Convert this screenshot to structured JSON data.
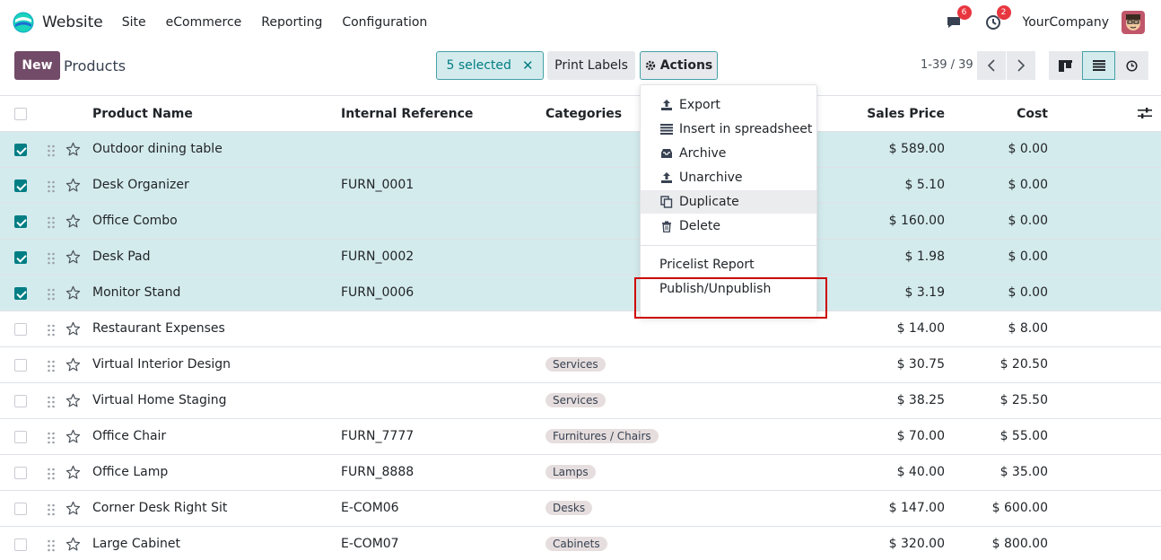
{
  "app": {
    "title": "Website",
    "menu": [
      "Site",
      "eCommerce",
      "Reporting",
      "Configuration"
    ],
    "messages_count": "6",
    "activities_count": "2",
    "company": "YourCompany"
  },
  "control": {
    "new_label": "New",
    "title": "Products",
    "selected_label": "5 selected",
    "clear_icon": "✕",
    "print_label": "Print Labels",
    "actions_label": "Actions",
    "pager": "1-39 / 39"
  },
  "columns": {
    "name": "Product Name",
    "ref": "Internal Reference",
    "categ": "Categories",
    "price": "Sales Price",
    "cost": "Cost"
  },
  "rows": [
    {
      "name": "Outdoor dining table",
      "ref": "",
      "categ": "",
      "price": "$ 589.00",
      "cost": "$ 0.00",
      "selected": true
    },
    {
      "name": "Desk Organizer",
      "ref": "FURN_0001",
      "categ": "",
      "price": "$ 5.10",
      "cost": "$ 0.00",
      "selected": true
    },
    {
      "name": "Office Combo",
      "ref": "",
      "categ": "",
      "price": "$ 160.00",
      "cost": "$ 0.00",
      "selected": true
    },
    {
      "name": "Desk Pad",
      "ref": "FURN_0002",
      "categ": "",
      "price": "$ 1.98",
      "cost": "$ 0.00",
      "selected": true
    },
    {
      "name": "Monitor Stand",
      "ref": "FURN_0006",
      "categ": "",
      "price": "$ 3.19",
      "cost": "$ 0.00",
      "selected": true
    },
    {
      "name": "Restaurant Expenses",
      "ref": "",
      "categ": "",
      "price": "$ 14.00",
      "cost": "$ 8.00",
      "selected": false
    },
    {
      "name": "Virtual Interior Design",
      "ref": "",
      "categ": "Services",
      "price": "$ 30.75",
      "cost": "$ 20.50",
      "selected": false
    },
    {
      "name": "Virtual Home Staging",
      "ref": "",
      "categ": "Services",
      "price": "$ 38.25",
      "cost": "$ 25.50",
      "selected": false
    },
    {
      "name": "Office Chair",
      "ref": "FURN_7777",
      "categ": "Furnitures / Chairs",
      "price": "$ 70.00",
      "cost": "$ 55.00",
      "selected": false
    },
    {
      "name": "Office Lamp",
      "ref": "FURN_8888",
      "categ": "Lamps",
      "price": "$ 40.00",
      "cost": "$ 35.00",
      "selected": false
    },
    {
      "name": "Corner Desk Right Sit",
      "ref": "E-COM06",
      "categ": "Desks",
      "price": "$ 147.00",
      "cost": "$ 600.00",
      "selected": false
    },
    {
      "name": "Large Cabinet",
      "ref": "E-COM07",
      "categ": "Cabinets",
      "price": "$ 320.00",
      "cost": "$ 800.00",
      "selected": false
    }
  ],
  "actions_menu": {
    "items": [
      {
        "label": "Export",
        "icon": "upload-icon"
      },
      {
        "label": "Insert in spreadsheet",
        "icon": "list-icon"
      },
      {
        "label": "Archive",
        "icon": "inbox-icon"
      },
      {
        "label": "Unarchive",
        "icon": "upload-icon"
      },
      {
        "label": "Duplicate",
        "icon": "copy-icon"
      },
      {
        "label": "Delete",
        "icon": "trash-icon"
      }
    ],
    "extra": [
      "Pricelist Report",
      "Publish/Unpublish"
    ],
    "highlighted": "Duplicate"
  },
  "colors": {
    "brand": "#714b67",
    "accent": "#017e84",
    "selected_row": "#d4ebed",
    "annotation": "#cc0000"
  }
}
